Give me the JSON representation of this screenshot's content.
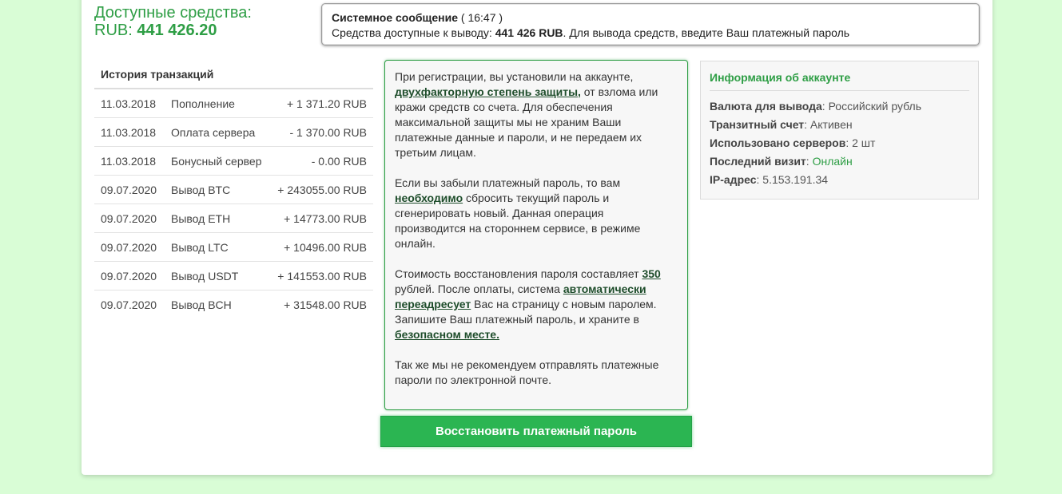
{
  "funds": {
    "label": "Доступные средства:",
    "currency": "RUB:",
    "amount": "441 426.20"
  },
  "system_message": {
    "title": "Системное сообщение",
    "time": "( 16:47 )",
    "text_before": "Средства доступные к выводу: ",
    "amount": "441 426 RUB",
    "text_after": ". Для вывода средств, введите Ваш платежный пароль"
  },
  "history": {
    "title": "История транзакций",
    "rows": [
      {
        "date": "11.03.2018",
        "desc": "Пополнение",
        "sum": "+ 1 371.20 RUB"
      },
      {
        "date": "11.03.2018",
        "desc": "Оплата сервера",
        "sum": "- 1 370.00 RUB"
      },
      {
        "date": "11.03.2018",
        "desc": "Бонусный сервер",
        "sum": "- 0.00 RUB"
      },
      {
        "date": "09.07.2020",
        "desc": "Вывод BTC",
        "sum": "+ 243055.00 RUB"
      },
      {
        "date": "09.07.2020",
        "desc": "Вывод ETH",
        "sum": "+ 14773.00 RUB"
      },
      {
        "date": "09.07.2020",
        "desc": "Вывод LTC",
        "sum": "+ 10496.00 RUB"
      },
      {
        "date": "09.07.2020",
        "desc": "Вывод USDT",
        "sum": "+ 141553.00 RUB"
      },
      {
        "date": "09.07.2020",
        "desc": "Вывод BCH",
        "sum": "+ 31548.00 RUB"
      }
    ]
  },
  "notice": {
    "p1_before": "При регистрации, вы установили на аккаунте, ",
    "p1_link": "двухфакторную степень защиты,",
    "p1_after": " от взлома или кражи средств со счета. Для обеспечения максимальной защиты мы не храним Ваши платежные данные и пароли, и не передаем их третьим лицам.",
    "p2_before": "Если вы забыли платежный пароль, то вам ",
    "p2_link": "необходимо",
    "p2_after": " сбросить текущий пароль и сгенерировать новый. Данная операция производится на стороннем сервисе, в режиме онлайн.",
    "p3_before": "Стоимость восстановления пароля составляет ",
    "p3_price": "350",
    "p3_mid": " рублей. После оплаты, система ",
    "p3_link": "автоматически переадресует",
    "p3_after": " Вас на страницу с новым паролем.",
    "p4_before": "Запишите Ваш платежный пароль, и храните в ",
    "p4_link": "безопасном месте.",
    "p5": "Так же мы не рекомендуем отправлять платежные пароли по электронной почте."
  },
  "restore_button": "Восстановить платежный пароль",
  "account": {
    "title": "Информация об аккаунте",
    "currency_label": "Валюта для вывода",
    "currency_value": " Российский рубль",
    "transit_label": "Транзитный счет",
    "transit_value": " Активен",
    "servers_label": "Использовано серверов",
    "servers_value": " 2 шт",
    "visit_label": "Последний визит",
    "visit_value": "Онлайн",
    "ip_label": "IP-адрес",
    "ip_value": " 5.153.191.34"
  }
}
